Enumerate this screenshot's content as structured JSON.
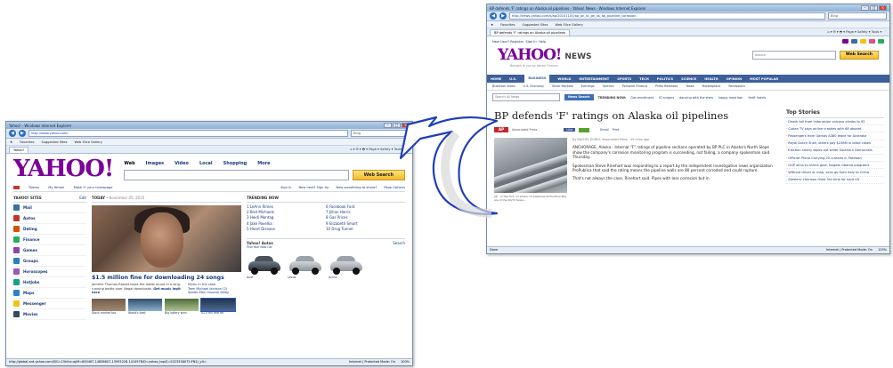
{
  "left_window": {
    "title": "Yahoo! - Windows Internet Explorer",
    "url": "http://www.yahoo.com/",
    "search_engine": "Bing",
    "tab_label": "Yahoo!",
    "status_url": "http://global.ard.yahoo.com/SIG=15hlhcuq/M=600467.14858607.13955228.1410978/D=yahoo_top/S=2023538075:FN2/_ylt=",
    "status_zone": "Internet | Protected Mode: On",
    "zoom": "100%",
    "favorites_items": [
      "Favorites",
      "Suggested Sites",
      "Web Slice Gallery"
    ],
    "yahoo": {
      "logo": "YAHOO!",
      "search_tabs": [
        "Web",
        "Images",
        "Video",
        "Local",
        "Shopping",
        "More"
      ],
      "search_button": "Web Search",
      "links": [
        "Taiwan",
        "My Yahoo!",
        "Make Y! your homepage"
      ],
      "account_links": [
        "Sign In",
        "New here? Sign Up",
        "New something to share?",
        "Page Options"
      ],
      "sites_title": "YAHOO! SITES",
      "sites_edit": "Edit",
      "sites": [
        {
          "label": "Mail",
          "color": "#3a6ea5"
        },
        {
          "label": "Autos",
          "color": "#c0392b"
        },
        {
          "label": "Dating",
          "color": "#d35400"
        },
        {
          "label": "Finance",
          "color": "#27ae60"
        },
        {
          "label": "Games",
          "color": "#8e44ad"
        },
        {
          "label": "Groups",
          "color": "#2980b9"
        },
        {
          "label": "Horoscopes",
          "color": "#9b59b6"
        },
        {
          "label": "HotJobs",
          "color": "#16a085"
        },
        {
          "label": "Maps",
          "color": "#2c82c9"
        },
        {
          "label": "Messenger",
          "color": "#f1c40f"
        },
        {
          "label": "Movies",
          "color": "#34495e"
        }
      ],
      "today_title": "TODAY",
      "today_date": "November 05, 2010",
      "today_headline": "$1.5 million fine for downloading 24 songs",
      "today_blurb": "Jammie Thomas-Rasset loses the latest round in a long-running battle over illegal downloads.",
      "today_blurb_link": "Get music legit here",
      "today_links": [
        "Music in the case",
        "Teen Michael Jackson (2)",
        "Spider-Man musical delay"
      ],
      "thumb_captions": [
        "Stock market too",
        "World's best",
        "Big lottery wins",
        "$1.5 mil fine for"
      ],
      "trending_title": "TRENDING NOW",
      "trending": [
        "1 LeAnn Rimes",
        "6 Facebook Font",
        "2 Bret Michaels",
        "7 Jillian Harris",
        "3 Heidi Montag",
        "8 Gas Prices",
        "4 Jake Pavelka",
        "9 Elizabeth Smart",
        "5 Heart Disease",
        "10 Drug Tunnel"
      ],
      "autos_title": "Yahoo! Autos",
      "autos_sub": "Find Your New Car",
      "autos_search": "Search",
      "cars": [
        "Audi",
        "Lexus",
        "Acura"
      ]
    }
  },
  "right_window": {
    "title": "BP defends 'F' ratings on Alaska oil pipelines - Yahoo! News - Windows Internet Explorer",
    "url": "http://news.yahoo.com/s/ap/20101105/ap_on_bi_ge_us_bp_pipeline_corrosion",
    "search_engine": "Bing",
    "tab_label": "BP defends 'F' ratings on Alaska oil pipelines",
    "status_left": "Done",
    "status_zone": "Internet | Protected Mode: On",
    "zoom": "125%",
    "news": {
      "top_links": [
        "New User? Register",
        "Sign In",
        "Help"
      ],
      "logo": "YAHOO!",
      "logo_news": "NEWS",
      "tagline": "Brought to you by Yahoo! Finance",
      "search_placeholder": "Search",
      "search_button": "Web Search",
      "nav": [
        "HOME",
        "U.S.",
        "BUSINESS",
        "WORLD",
        "ENTERTAINMENT",
        "SPORTS",
        "TECH",
        "POLITICS",
        "SCIENCE",
        "HEALTH",
        "OPINION",
        "MOST POPULAR"
      ],
      "subnav": [
        "Business Video",
        "U.S. Economy",
        "Stock Markets",
        "Earnings",
        "Opinion",
        "Personal Finance",
        "Press Releases",
        "Taxes",
        "Marketplace",
        "Recessions"
      ],
      "search_news_placeholder": "Search All News",
      "news_search_button": "News Search",
      "trending_label": "TRENDING NOW:",
      "trending_links": [
        "Gas enrollment",
        "ID snipers",
        "dancing with the stars",
        "happy meal ban",
        "thrift hotels"
      ],
      "headline": "BP defends 'F' ratings on Alaska oil pipelines",
      "source": "Associated Press",
      "byline": "By RACHEL D'ORO, Associated Press - 49 mins ago",
      "share_like": "Like",
      "share_email": "Email",
      "share_print": "Print",
      "photo_caption": "AP - In this Oct. 17 photo, oil pipelines at Prudhoe Bay are in the North Slope...",
      "paragraphs": [
        "ANCHORAGE, Alaska - Internal \"F\" ratings of pipeline sections operated by BP PLC in Alaska's North Slope show the company's corrosion monitoring program is succeeding, not failing, a company spokesman said Thursday.",
        "Spokesman Steve Rinehart was responding to a report by the independent investigative news organization ProPublica that said the rating means the pipeline walls are 80 percent corroded and could rupture.",
        "That's not always the case, Rinehart said. Pipes with less corrosion but in"
      ],
      "top_stories_title": "Top Stories",
      "top_stories": [
        "Death toll from Indonesian volcano climbs to 92",
        "Cuban TV says airline crashes with 68 aboard",
        "Passengers from Qantas A380 leave for Australia",
        "Royal Dutch Shell, others pay $236M in bribe cases",
        "Election nearly wipes out white Southern Democrats",
        "Official: Plane Carrying 20 crashes in Pakistan",
        "GOP aims to shrink govt, targets Obama programs",
        "Without driver or map, vans go from Italy to China",
        "Steelers' Harrison fined 3rd time for hard hit"
      ]
    }
  },
  "arrow_color": "#1f3fb8"
}
